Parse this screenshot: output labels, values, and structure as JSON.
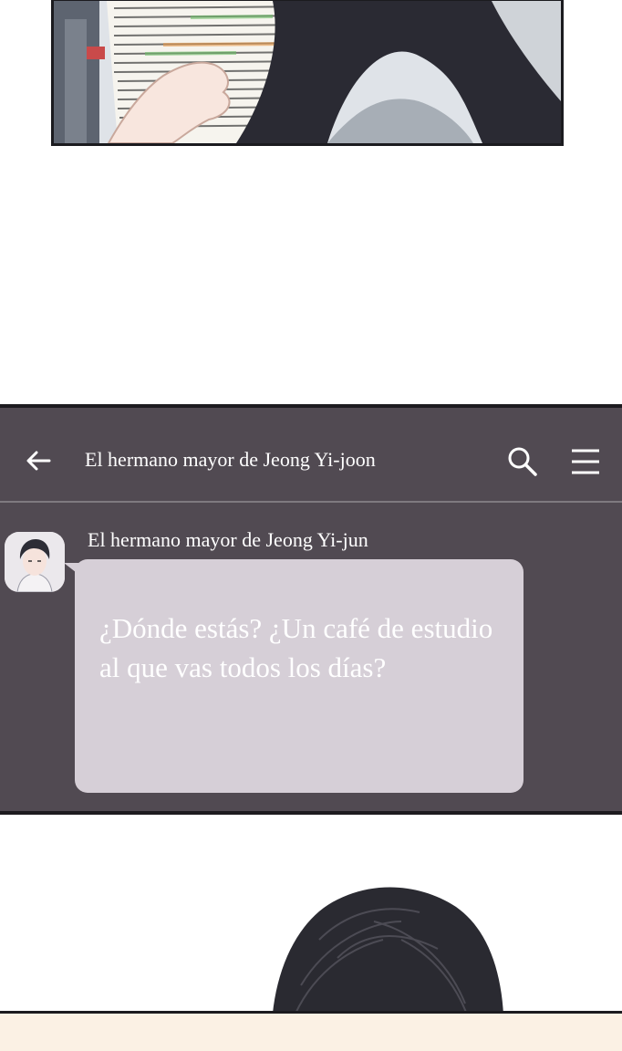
{
  "chat": {
    "title": "El hermano mayor de Jeong Yi-joon",
    "sender_name": "El hermano mayor de Jeong Yi-jun",
    "message": "¿Dónde estás? ¿Un café de estudio al que vas todos los días?",
    "icons": {
      "back": "arrow-left-icon",
      "search": "search-icon",
      "menu": "hamburger-menu-icon",
      "avatar": "avatar"
    }
  },
  "colors": {
    "chat_background": "#514a52",
    "bubble": "#d6cfd7",
    "header_divider": "#7f7a80",
    "text": "#ffffff"
  }
}
